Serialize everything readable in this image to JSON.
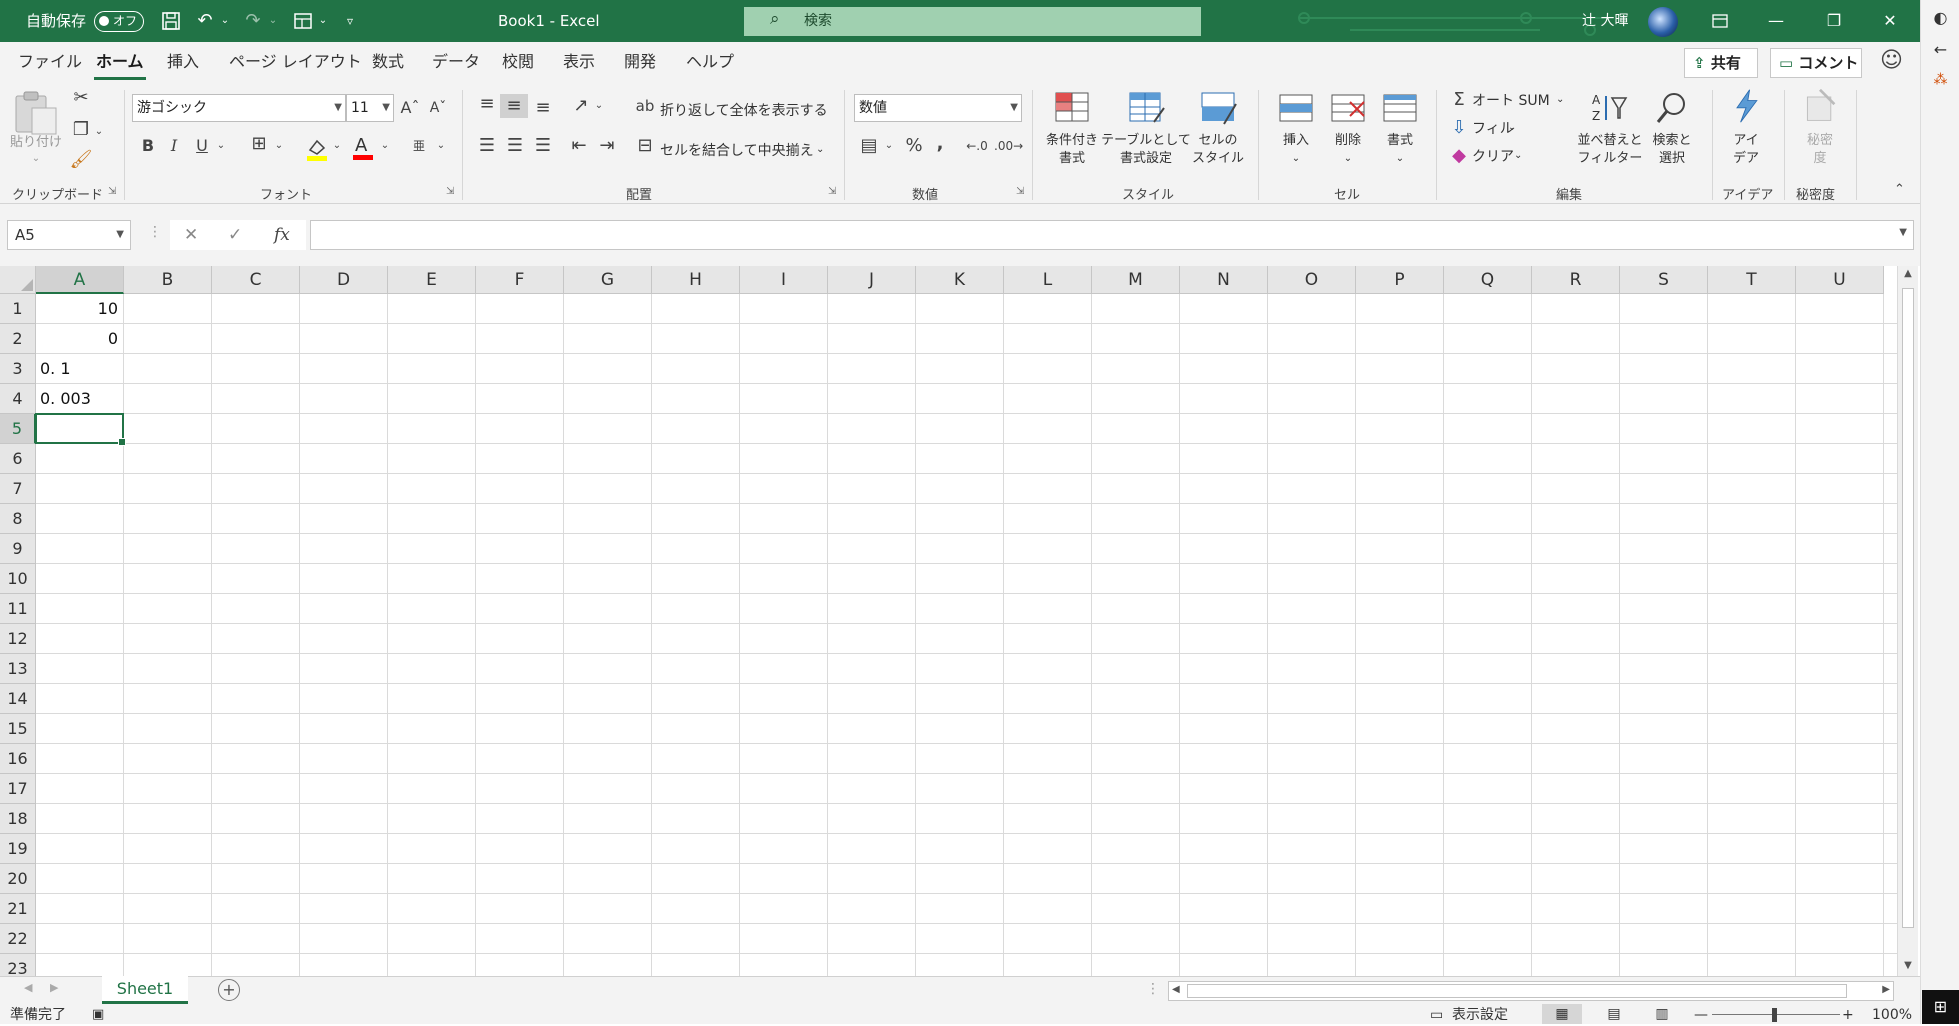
{
  "title_bar": {
    "autosave_label": "自動保存",
    "autosave_state": "オフ",
    "doc_title": "Book1  -  Excel",
    "search_placeholder": "検索",
    "user_name": "辻 大暉"
  },
  "menu_tabs": [
    "ファイル",
    "ホーム",
    "挿入",
    "ページ レイアウト",
    "数式",
    "データ",
    "校閲",
    "表示",
    "開発",
    "ヘルプ"
  ],
  "active_tab": "ホーム",
  "top_buttons": {
    "share": "共有",
    "comment": "コメント"
  },
  "ribbon": {
    "clipboard": {
      "paste": "貼り付け",
      "label": "クリップボード"
    },
    "font": {
      "name": "游ゴシック",
      "size": "11",
      "bold": "B",
      "italic": "I",
      "underline": "U",
      "grow": "A^",
      "shrink": "Aˇ",
      "label": "フォント"
    },
    "alignment": {
      "wrap": "折り返して全体を表示する",
      "merge": "セルを結合して中央揃え",
      "label": "配置"
    },
    "number": {
      "format": "数値",
      "percent": "%",
      "comma": ",",
      "label": "数値"
    },
    "styles": {
      "conditional": [
        "条件付き",
        "書式"
      ],
      "table": [
        "テーブルとして",
        "書式設定"
      ],
      "cell_styles": [
        "セルの",
        "スタイル"
      ],
      "label": "スタイル"
    },
    "cells": {
      "insert": "挿入",
      "delete": "削除",
      "format": "書式",
      "label": "セル"
    },
    "editing": {
      "autosum": "オート SUM",
      "fill": "フィル",
      "clear": "クリア",
      "sort": [
        "並べ替えと",
        "フィルター"
      ],
      "find": [
        "検索と",
        "選択"
      ],
      "label": "編集"
    },
    "ideas": {
      "button": [
        "アイ",
        "デア"
      ],
      "label": "アイデア"
    },
    "sensitivity": {
      "button": [
        "秘密",
        "度"
      ],
      "label": "秘密度"
    }
  },
  "formula_bar": {
    "name_box": "A5",
    "fx": "fx",
    "formula": ""
  },
  "grid": {
    "columns": [
      "A",
      "B",
      "C",
      "D",
      "E",
      "F",
      "G",
      "H",
      "I",
      "J",
      "K",
      "L",
      "M",
      "N",
      "O",
      "P",
      "Q",
      "R",
      "S",
      "T",
      "U"
    ],
    "rows": [
      "1",
      "2",
      "3",
      "4",
      "5",
      "6",
      "7",
      "8",
      "9",
      "10",
      "11",
      "12",
      "13",
      "14",
      "15",
      "16",
      "17",
      "18",
      "19",
      "20",
      "21",
      "22",
      "23"
    ],
    "cells": {
      "A1": "10",
      "A2": "0",
      "A3": "0. 1",
      "A4": "0. 003"
    },
    "active_cell": "A5"
  },
  "sheets": [
    "Sheet1"
  ],
  "status_bar": {
    "ready": "準備完了",
    "display_settings": "表示設定",
    "zoom": "100%"
  },
  "colors": {
    "accent": "#217346",
    "ribbon_bg": "#f3f3f3",
    "header_bg": "#e6e6e6"
  }
}
